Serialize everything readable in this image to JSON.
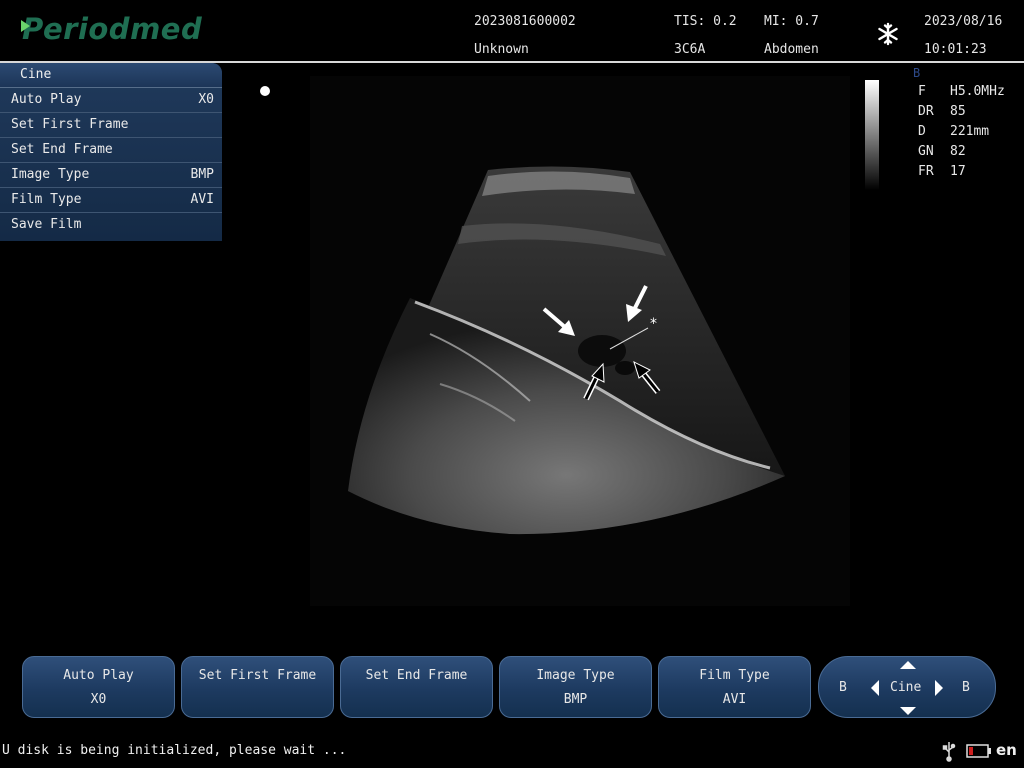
{
  "header": {
    "logo_text": "Periodmed",
    "exam_id": "2023081600002",
    "patient_name": "Unknown",
    "tis": "TIS: 0.2",
    "mi": "MI: 0.7",
    "probe": "3C6A",
    "preset": "Abdomen",
    "freeze_icon": "snowflake-icon",
    "date": "2023/08/16",
    "time": "10:01:23"
  },
  "cine_menu": {
    "title": "Cine",
    "items": [
      {
        "label": "Auto Play",
        "value": "X0"
      },
      {
        "label": "Set First Frame",
        "value": ""
      },
      {
        "label": "Set End Frame",
        "value": ""
      },
      {
        "label": "Image Type",
        "value": "BMP"
      },
      {
        "label": "Film Type",
        "value": "AVI"
      },
      {
        "label": "Save Film",
        "value": ""
      }
    ]
  },
  "image_params": {
    "mode": "B",
    "rows": [
      {
        "key": "F",
        "value": "H5.0MHz"
      },
      {
        "key": "DR",
        "value": "85"
      },
      {
        "key": "D",
        "value": "221mm"
      },
      {
        "key": "GN",
        "value": "82"
      },
      {
        "key": "FR",
        "value": "17"
      }
    ]
  },
  "annotations": {
    "asterisk": "*"
  },
  "softkeys": [
    {
      "label": "Auto Play",
      "value": "X0"
    },
    {
      "label": "Set First Frame",
      "value": ""
    },
    {
      "label": "Set End Frame",
      "value": ""
    },
    {
      "label": "Image Type",
      "value": "BMP"
    },
    {
      "label": "Film Type",
      "value": "AVI"
    }
  ],
  "nav_control": {
    "center_label": "Cine",
    "left_label": "B",
    "right_label": "B"
  },
  "status": {
    "message": "U disk is being initialized, please wait ...",
    "language": "en",
    "icons": [
      "usb-icon",
      "battery-icon"
    ]
  },
  "colors": {
    "logo": "#1f6e52",
    "logo_mark": "#6bd36b",
    "menu_bg": "#1c3558",
    "softkey_bg": "#1d3a60",
    "mode_label": "#2d4a8a",
    "battery_alert": "#d02020"
  }
}
